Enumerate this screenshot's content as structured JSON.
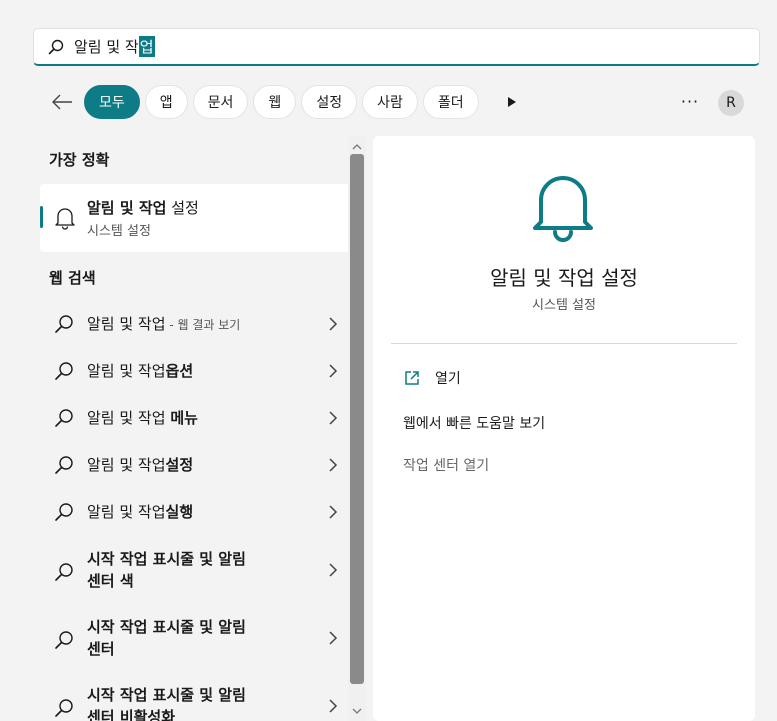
{
  "search": {
    "query_prefix": "알림 및 작",
    "query_selected": "업"
  },
  "filters": [
    {
      "label": "모두",
      "active": true
    },
    {
      "label": "앱",
      "active": false
    },
    {
      "label": "문서",
      "active": false
    },
    {
      "label": "웹",
      "active": false
    },
    {
      "label": "설정",
      "active": false
    },
    {
      "label": "사람",
      "active": false
    },
    {
      "label": "폴더",
      "active": false
    }
  ],
  "toolbar": {
    "more": "···",
    "avatar_initial": "R"
  },
  "best_match": {
    "heading": "가장 정확",
    "title_bold": "알림 및 작업",
    "title_rest": " 설정",
    "subtitle": "시스템 설정"
  },
  "web_search": {
    "heading": "웹 검색",
    "items": [
      {
        "line1_plain": "알림 및 작업",
        "line1_bold": "",
        "line1_small": " - 웹 결과 보기",
        "line2": ""
      },
      {
        "line1_plain": "알림 및 작업",
        "line1_bold": "옵션",
        "line1_small": "",
        "line2": ""
      },
      {
        "line1_plain": "알림 및 작업 ",
        "line1_bold": "메뉴",
        "line1_small": "",
        "line2": ""
      },
      {
        "line1_plain": "알림 및 작업",
        "line1_bold": "설정",
        "line1_small": "",
        "line2": ""
      },
      {
        "line1_plain": "알림 및 작업",
        "line1_bold": "실행",
        "line1_small": "",
        "line2": ""
      },
      {
        "line1_plain": "",
        "line1_bold": "시작 작업 표시줄 및 알림",
        "line1_small": "",
        "line2": "센터 색"
      },
      {
        "line1_plain": "",
        "line1_bold": "시작 작업 표시줄 및 알림",
        "line1_small": "",
        "line2": "센터"
      },
      {
        "line1_plain": "",
        "line1_bold": "시작 작업 표시줄 및 알림",
        "line1_small": "",
        "line2": "센터 비활성화"
      }
    ]
  },
  "detail": {
    "title": "알림 및 작업 설정",
    "subtitle": "시스템 설정",
    "actions": {
      "open": "열기",
      "help": "웹에서 빠른 도움말 보기",
      "center": "작업 센터 열기"
    }
  },
  "colors": {
    "accent": "#0e7c86"
  }
}
